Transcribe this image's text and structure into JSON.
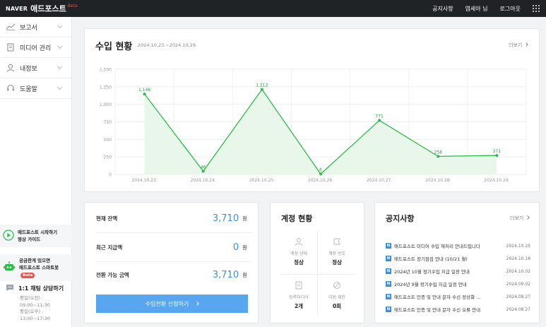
{
  "topbar": {
    "logo_naver": "NAVER",
    "logo_main": "애드포스트",
    "logo_beta": "Beta",
    "links": [
      "공지사항",
      "염세아 님",
      "로그아웃"
    ]
  },
  "sidebar": {
    "menu": [
      {
        "label": "보고서",
        "icon": "chart-line-icon"
      },
      {
        "label": "미디어 관리",
        "icon": "document-icon"
      },
      {
        "label": "내정보",
        "icon": "user-icon"
      },
      {
        "label": "도움말",
        "icon": "headset-icon"
      }
    ],
    "banner_guide": {
      "line1": "애드포스트 시작하기",
      "line2": "영상 가이드"
    },
    "banner_bot": {
      "line1": "궁금한게 있으면",
      "line2": "애드포스트 스마트봇",
      "badge": "Beta"
    },
    "chat": {
      "title": "1:1 채팅 상담하기",
      "hours": [
        "평일(오전) :",
        "09:00~11:30",
        "평일(오후) :",
        "13:00~17:30"
      ]
    }
  },
  "income": {
    "title": "수입 현황",
    "range": "2024.10.23.~2024.10.29.",
    "more": "더보기"
  },
  "chart_data": {
    "type": "line",
    "categories": [
      "2024.10.23.",
      "2024.10.24.",
      "2024.10.25.",
      "2024.10.26.",
      "2024.10.27.",
      "2024.10.28.",
      "2024.10.29."
    ],
    "values": [
      1146,
      46,
      1212,
      6,
      771,
      258,
      271
    ],
    "value_labels": [
      "1,146",
      "46",
      "1,212",
      "6",
      "771",
      "258",
      "271"
    ],
    "yticks": [
      0,
      250,
      500,
      750,
      1000,
      1250,
      1500
    ],
    "ytick_labels": [
      "0",
      "250",
      "500",
      "750",
      "1,000",
      "1,250",
      "1,500"
    ],
    "ylim": [
      0,
      1500
    ],
    "color": "#2bbd49",
    "fill": "#e9f7ea",
    "grid": true
  },
  "balance": {
    "rows": [
      {
        "label": "현재 잔액",
        "value": "3,710",
        "unit": "원"
      },
      {
        "label": "최근 지급액",
        "value": "0",
        "unit": "원"
      },
      {
        "label": "전환 가능 금액",
        "value": "3,710",
        "unit": "원"
      }
    ],
    "button": "수입전환 신청하기"
  },
  "account": {
    "title": "계정 현황",
    "cells": [
      {
        "label": "계정 상태",
        "value": "정상",
        "icon": "user-icon"
      },
      {
        "label": "계좌 번호",
        "value": "정상",
        "icon": "bank-icon"
      },
      {
        "label": "등록미디어",
        "value": "2개",
        "icon": "document-icon"
      },
      {
        "label": "이용 제한",
        "value": "0회",
        "icon": "ban-icon"
      }
    ]
  },
  "notice": {
    "title": "공지사항",
    "more": "더보기",
    "badge": "N",
    "items": [
      {
        "text": "애드포스트 미디어 수입 재처리 안내드립니다",
        "date": "2024.10.25"
      },
      {
        "text": "애드포스트 정기점검 안내 (10/21 월)",
        "date": "2024.10.18"
      },
      {
        "text": "2024년 10월 정기수입 지급 일정 안내",
        "date": "2024.10.02"
      },
      {
        "text": "2024년 9월 정기수입 지급 일정 안내",
        "date": "2024.09.02"
      },
      {
        "text": "애드포스트 인증 및 안내 문자 수신 정상화 ...",
        "date": "2024.08.27"
      },
      {
        "text": "애드포스트 인증 및 안내 문자 수신 오류 안내",
        "date": "2024.08.27"
      }
    ]
  }
}
